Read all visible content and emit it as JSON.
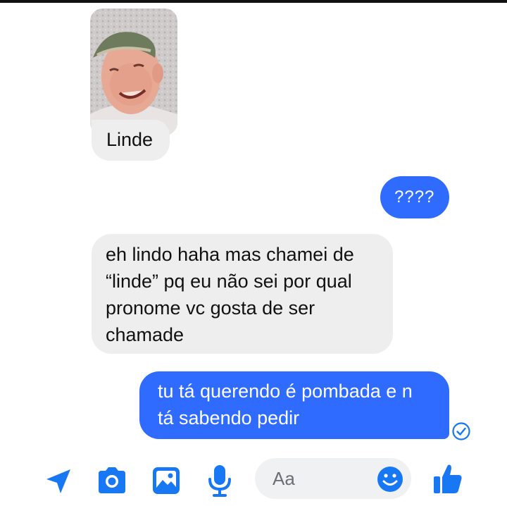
{
  "messages": [
    {
      "id": "m1",
      "direction": "received",
      "type": "photo",
      "photo_description": "selfie of a young man wearing a cap"
    },
    {
      "id": "m2",
      "direction": "received",
      "text": "Linde"
    },
    {
      "id": "m3",
      "direction": "sent",
      "text": "????"
    },
    {
      "id": "m4",
      "direction": "received",
      "lines": [
        "eh lindo haha mas chamei de",
        "“linde” pq eu não sei por qual",
        "pronome vc gosta de ser",
        "chamade"
      ]
    },
    {
      "id": "m5",
      "direction": "sent",
      "lines": [
        "tu tá querendo é pombada e n",
        "tá sabendo pedir"
      ],
      "status": "sent-check"
    }
  ],
  "composer": {
    "placeholder": "Aa"
  },
  "toolbar": {
    "icons": [
      "location-icon",
      "camera-icon",
      "gallery-icon",
      "microphone-icon",
      "emoji-icon",
      "like-icon"
    ]
  },
  "colors": {
    "sent_bubble": "#2f6bff",
    "received_bubble": "#eeeeef",
    "accent": "#1877f2"
  }
}
